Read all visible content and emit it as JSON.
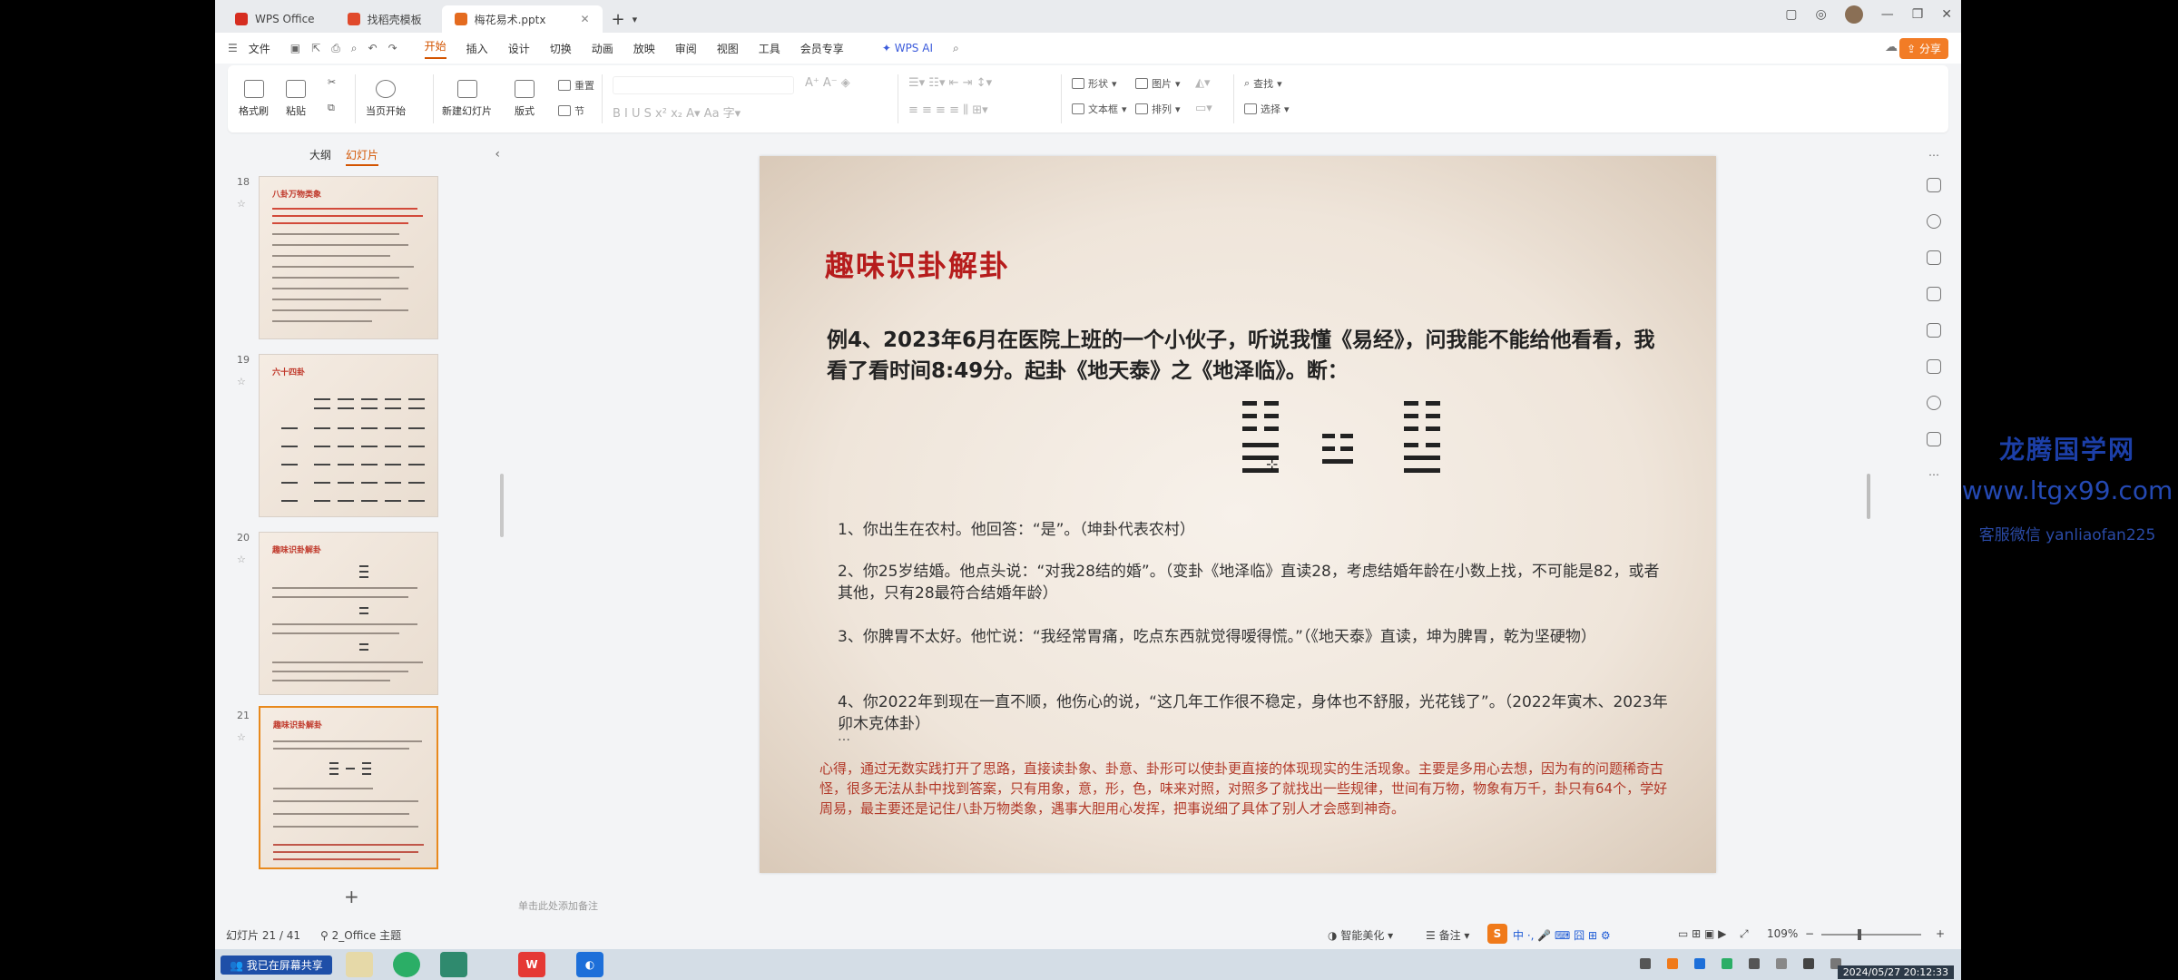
{
  "tabs": [
    {
      "label": "WPS Office",
      "color": "#d62d20"
    },
    {
      "label": "找稻壳模板",
      "color": "#e0492b"
    },
    {
      "label": "梅花易术.pptx",
      "color": "#e46b1f",
      "active": true
    }
  ],
  "menu": {
    "file": "文件",
    "items": [
      "开始",
      "插入",
      "设计",
      "切换",
      "动画",
      "放映",
      "审阅",
      "视图",
      "工具",
      "会员专享"
    ],
    "active_index": 0,
    "ai": "WPS AI",
    "share": "分享"
  },
  "ribbon": {
    "format_painter": "格式刷",
    "paste": "粘贴",
    "from_current": "当页开始",
    "new_slide": "新建幻灯片",
    "layout": "版式",
    "reset": "重置",
    "section": "节",
    "shape": "形状",
    "picture": "图片",
    "find": "查找",
    "textbox": "文本框",
    "arrange": "排列",
    "select": "选择"
  },
  "panel": {
    "tab_outline": "大纲",
    "tab_slides": "幻灯片",
    "thumbs": [
      {
        "num": "18",
        "title": "八卦万物类象"
      },
      {
        "num": "19",
        "title": "六十四卦"
      },
      {
        "num": "20",
        "title": "趣味识卦解卦"
      },
      {
        "num": "21",
        "title": "趣味识卦解卦",
        "selected": true
      }
    ]
  },
  "slide": {
    "title": "趣味识卦解卦",
    "intro": "例4、2023年6月在医院上班的一个小伙子，听说我懂《易经》，问我能不能给他看看，我看了看时间8:49分。起卦《地天泰》之《地泽临》。断：",
    "points": [
      "1、你出生在农村。他回答：“是”。（坤卦代表农村）",
      "2、你25岁结婚。他点头说：“对我28结的婚”。（变卦《地泽临》直读28，考虑结婚年龄在小数上找，不可能是82，或者其他，只有28最符合结婚年龄）",
      "3、你脾胃不太好。他忙说：“我经常胃痛，吃点东西就觉得嗳得慌。”（《地天泰》直读，坤为脾胃，乾为坚硬物）",
      "4、你2022年到现在一直不顺，他伤心的说，“这几年工作很不稳定，身体也不舒服，光花钱了”。（2022年寅木、2023年卯木克体卦）"
    ],
    "ellipsis": "…",
    "summary": "心得，通过无数实践打开了思路，直接读卦象、卦意、卦形可以使卦更直接的体现现实的生活现象。主要是多用心去想，因为有的问题稀奇古怪，很多无法从卦中找到答案，只有用象，意，形，色，味来对照，对照多了就找出一些规律，世间有万物，物象有万千，卦只有64个，学好周易，最主要还是记住八卦万物类象，遇事大胆用心发挥，把事说细了具体了别人才会感到神奇。"
  },
  "notes_placeholder": "单击此处添加备注",
  "status": {
    "slide_counter": "幻灯片 21 / 41",
    "theme": "2_Office 主题",
    "smart_beautify": "智能美化",
    "notes": "备注",
    "zoom": "109%"
  },
  "taskbar": {
    "share_label": "我已在屏幕共享",
    "clock": "2024/05/27 20:12:33"
  },
  "watermark": {
    "line1": "龙腾国学网",
    "line2": "www.ltgx99.com",
    "line3": "客服微信 yanliaofan225"
  }
}
